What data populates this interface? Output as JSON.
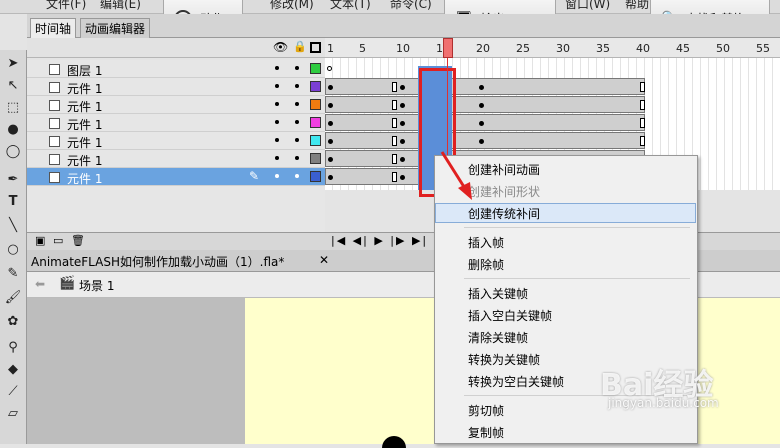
{
  "menubar": {
    "items": [
      "文件(F)",
      "编辑(E)",
      "修改(M)",
      "文本(T)",
      "命令(C)",
      "窗口(W)",
      "帮助"
    ],
    "btn_action": "动作",
    "btn_output": "输出",
    "btn_find_replace": "查找和替换"
  },
  "timeline": {
    "tabs": [
      "时间轴",
      "动画编辑器"
    ],
    "ticks": [
      "1",
      "5",
      "10",
      "15",
      "20",
      "25",
      "30",
      "35",
      "40",
      "45",
      "50",
      "55"
    ],
    "layers": [
      {
        "name": "图层 1",
        "color": "#2ecc40",
        "selected": false
      },
      {
        "name": "元件 1",
        "color": "#7b3fd4",
        "selected": false
      },
      {
        "name": "元件 1",
        "color": "#f07b10",
        "selected": false
      },
      {
        "name": "元件 1",
        "color": "#f040e0",
        "selected": false
      },
      {
        "name": "元件 1",
        "color": "#40e8f0",
        "selected": false
      },
      {
        "name": "元件 1",
        "color": "#808080",
        "selected": false
      },
      {
        "name": "元件 1",
        "color": "#3a5fd0",
        "selected": true
      }
    ]
  },
  "document": {
    "name": "AnimateFLASH如何制作加载小动画（1）.fla*",
    "breadcrumb": "场景 1"
  },
  "context_menu": {
    "items": [
      {
        "label": "创建补间动画",
        "disabled": false
      },
      {
        "label": "创建补间形状",
        "disabled": true
      },
      {
        "label": "创建传统补间",
        "disabled": false,
        "highlighted": true
      },
      {
        "label": "插入帧",
        "disabled": false
      },
      {
        "label": "删除帧",
        "disabled": false
      },
      {
        "label": "插入关键帧",
        "disabled": false
      },
      {
        "label": "插入空白关键帧",
        "disabled": false
      },
      {
        "label": "清除关键帧",
        "disabled": false
      },
      {
        "label": "转换为关键帧",
        "disabled": false
      },
      {
        "label": "转换为空白关键帧",
        "disabled": false
      },
      {
        "label": "剪切帧",
        "disabled": false
      },
      {
        "label": "复制帧",
        "disabled": false
      }
    ]
  },
  "watermark": {
    "main": "Bai经验",
    "sub": "jingyan.baidu.com"
  },
  "colors": {
    "accent": "#5b8ed8",
    "annotation": "#e02020",
    "stage": "#ffffcc"
  }
}
